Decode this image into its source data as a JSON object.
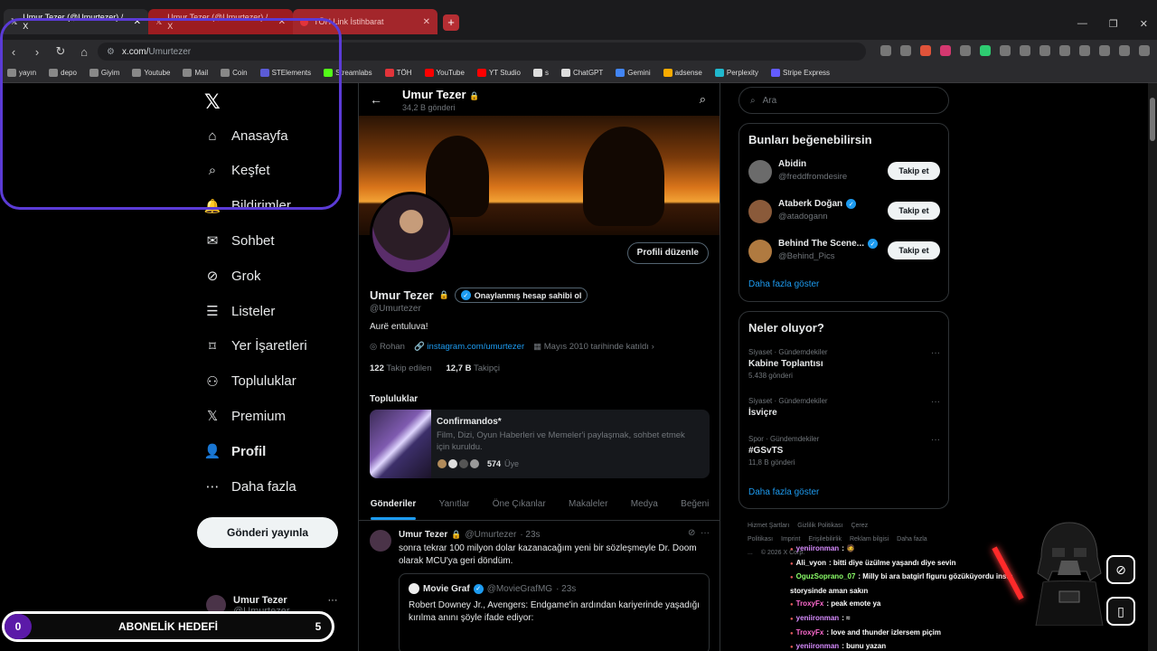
{
  "browser": {
    "tabs": [
      {
        "label": "Umur Tezer (@Umurtezer) / X",
        "active": true
      },
      {
        "label": "Umur Tezer (@Umurtezer) / X",
        "active": false
      },
      {
        "label": "TÖH Link İstihbarat",
        "active": false
      }
    ],
    "url_host": "x.com/",
    "url_path": "Umurtezer",
    "bookmarks": [
      "yayın",
      "depo",
      "Giyim",
      "Youtube",
      "Mail",
      "Coin",
      "STElements",
      "Streamlabs",
      "TÖH",
      "YouTube",
      "YT Studio",
      "s",
      "ChatGPT",
      "Gemini",
      "adsense",
      "Perplexity",
      "Stripe Express"
    ]
  },
  "nav": {
    "items": [
      "Anasayfa",
      "Keşfet",
      "Bildirimler",
      "Sohbet",
      "Grok",
      "Listeler",
      "Yer İşaretleri",
      "Topluluklar",
      "Premium",
      "Profil",
      "Daha fazla"
    ],
    "post_button": "Gönderi yayınla",
    "account_name": "Umur Tezer",
    "account_handle": "@Umurtezer"
  },
  "header": {
    "name": "Umur Tezer",
    "posts": "34,2 B gönderi"
  },
  "profile": {
    "edit_button": "Profili düzenle",
    "name": "Umur Tezer",
    "verified_pill": "Onaylanmış hesap sahibi ol",
    "handle": "@Umurtezer",
    "bio": "Aurë entuluva!",
    "location": "Rohan",
    "link": "instagram.com/umurtezer",
    "joined": "Mayıs 2010 tarihinde katıldı",
    "following_count": "122",
    "following_label": "Takip edilen",
    "followers_count": "12,7 B",
    "followers_label": "Takipçi"
  },
  "communities": {
    "heading": "Topluluklar",
    "name": "Confirmandos*",
    "description": "Film, Dizi, Oyun Haberleri ve Memeler'i paylaşmak, sohbet etmek için kuruldu.",
    "members": "574",
    "members_label": "Üye"
  },
  "profile_tabs": [
    "Gönderiler",
    "Yanıtlar",
    "Öne Çıkanlar",
    "Makaleler",
    "Medya",
    "Beğeni"
  ],
  "tweet": {
    "name": "Umur Tezer",
    "handle": "@Umurtezer",
    "time": "· 23s",
    "text": "sonra tekrar 100 milyon dolar kazanacağım yeni bir sözleşmeyle Dr. Doom olarak MCU'ya geri döndüm.",
    "quote_name": "Movie Graf",
    "quote_handle": "@MovieGrafMG",
    "quote_time": "· 23s",
    "quote_text": "Robert Downey Jr., Avengers: Endgame'in ardından kariyerinde yaşadığı kırılma anını şöyle ifade ediyor:"
  },
  "right": {
    "search_placeholder": "Ara",
    "who_to_follow_title": "Bunları beğenebilirsin",
    "suggestions": [
      {
        "name": "Abidin",
        "handle": "@freddfromdesire",
        "verified": false
      },
      {
        "name": "Ataberk Doğan",
        "handle": "@atadogann",
        "verified": true
      },
      {
        "name": "Behind The Scene...",
        "handle": "@Behind_Pics",
        "verified": true
      }
    ],
    "follow_label": "Takip et",
    "show_more": "Daha fazla göster",
    "trends_title": "Neler oluyor?",
    "trends": [
      {
        "category": "Siyaset · Gündemdekiler",
        "title": "Kabine Toplantısı",
        "count": "5.438 gönderi"
      },
      {
        "category": "Siyaset · Gündemdekiler",
        "title": "İsviçre",
        "count": ""
      },
      {
        "category": "Spor · Gündemdekiler",
        "title": "#GSvTS",
        "count": "11,8 B gönderi"
      }
    ],
    "footer": [
      "Hizmet Şartları",
      "Gizlilik Politikası",
      "Çerez Politikası",
      "Imprint",
      "Erişilebilirlik",
      "Reklam bilgisi",
      "Daha fazla ...",
      "© 2026 X Corp."
    ]
  },
  "overlay": {
    "goal_left": "0",
    "goal_label": "ABONELİK HEDEFİ",
    "goal_right": "5",
    "chat": [
      {
        "user": "yeniironman",
        "msg": ": 🧔",
        "color": "#d88cff"
      },
      {
        "user": "Ali_vyon",
        "msg": ": bitti diye üzülme yaşandı diye sevin",
        "color": "#ffffff"
      },
      {
        "user": "OguzSoprano_07",
        "msg": ": Milly bi ara batgirl figuru gözüküyordu insta storysinde aman sakın",
        "color": "#8cff6a"
      },
      {
        "user": "TroxyFx",
        "msg": ": peak emote ya",
        "color": "#ff6bd0"
      },
      {
        "user": "yeniironman",
        "msg": ": ≈",
        "color": "#d88cff"
      },
      {
        "user": "TroxyFx",
        "msg": ": love and thunder izlersem piçim",
        "color": "#ff6bd0"
      },
      {
        "user": "yeniironman",
        "msg": ": bunu yazan",
        "color": "#d88cff"
      }
    ],
    "accent": "#5b3bd6"
  }
}
